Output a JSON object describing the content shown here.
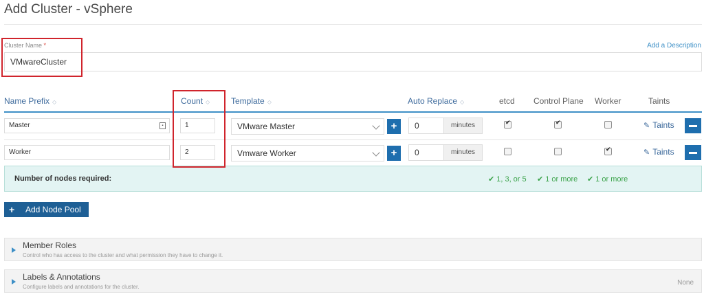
{
  "page": {
    "title": "Add Cluster - vSphere"
  },
  "cluster_name": {
    "label": "Cluster Name",
    "required_mark": "*",
    "value": "VMwareCluster",
    "add_description": "Add a Description"
  },
  "node_table": {
    "columns": {
      "name_prefix": "Name Prefix",
      "count": "Count",
      "template": "Template",
      "auto_replace": "Auto Replace",
      "etcd": "etcd",
      "control_plane": "Control Plane",
      "worker": "Worker",
      "taints": "Taints"
    },
    "rows": [
      {
        "name_prefix": "Master",
        "count": "1",
        "template": "VMware Master",
        "auto_replace": "0",
        "unit": "minutes",
        "etcd": true,
        "control_plane": true,
        "worker": false,
        "taints_label": "Taints"
      },
      {
        "name_prefix": "Worker",
        "count": "2",
        "template": "Vmware Worker",
        "auto_replace": "0",
        "unit": "minutes",
        "etcd": false,
        "control_plane": false,
        "worker": true,
        "taints_label": "Taints"
      }
    ]
  },
  "requirements": {
    "label": "Number of nodes required:",
    "etcd": "1, 3, or 5",
    "control_plane": "1 or more",
    "worker": "1 or more"
  },
  "add_node_pool": {
    "label": "Add Node Pool"
  },
  "sections": {
    "member_roles": {
      "title": "Member Roles",
      "subtitle": "Control who has access to the cluster and what permission they have to change it."
    },
    "labels_annotations": {
      "title": "Labels & Annotations",
      "subtitle": "Configure labels and annotations for the cluster.",
      "value": "None"
    }
  },
  "colors": {
    "accent": "#1e6eae",
    "link": "#3d6a9c",
    "highlight_box": "#d0242c",
    "success": "#3ba34a",
    "requirements_bg": "#e3f4f3"
  }
}
